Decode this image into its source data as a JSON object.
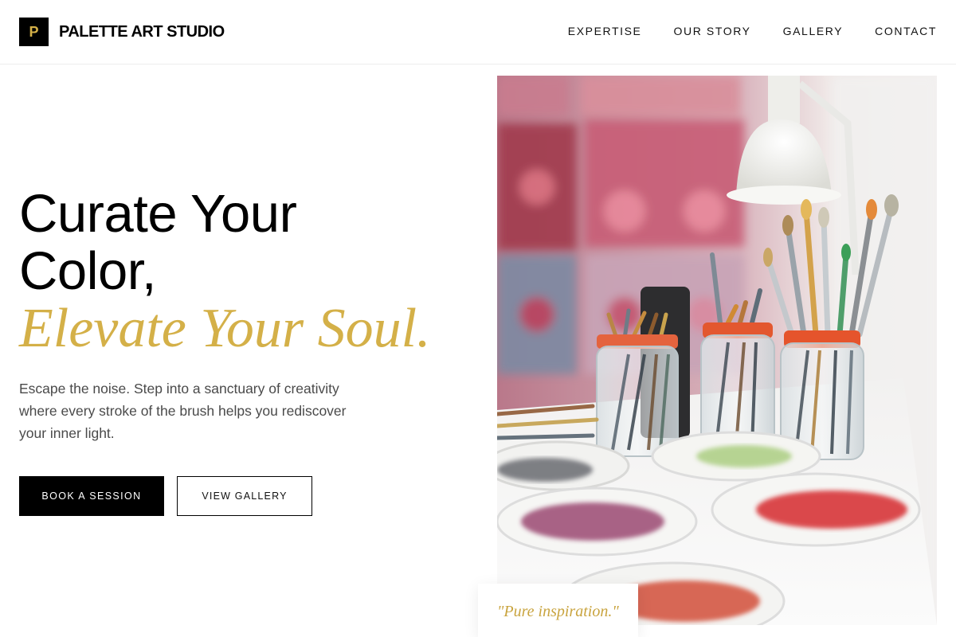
{
  "brand": {
    "logo_letter": "P",
    "name": "PALETTE ART STUDIO",
    "accent_color": "#d4b048"
  },
  "nav": {
    "items": [
      {
        "label": "EXPERTISE"
      },
      {
        "label": "OUR STORY"
      },
      {
        "label": "GALLERY"
      },
      {
        "label": "CONTACT"
      }
    ]
  },
  "hero": {
    "title_line1": "Curate Your",
    "title_line2": "Color,",
    "title_accent": "Elevate Your Soul.",
    "description": "Escape the noise. Step into a sanctuary of creativity where every stroke of the brush helps you rediscover your inner light.",
    "primary_button": "BOOK A SESSION",
    "secondary_button": "VIEW GALLERY",
    "image_subject": "paint-brushes-in-jars-with-palettes-photo"
  },
  "quote": {
    "text": "\"Pure inspiration.\""
  }
}
